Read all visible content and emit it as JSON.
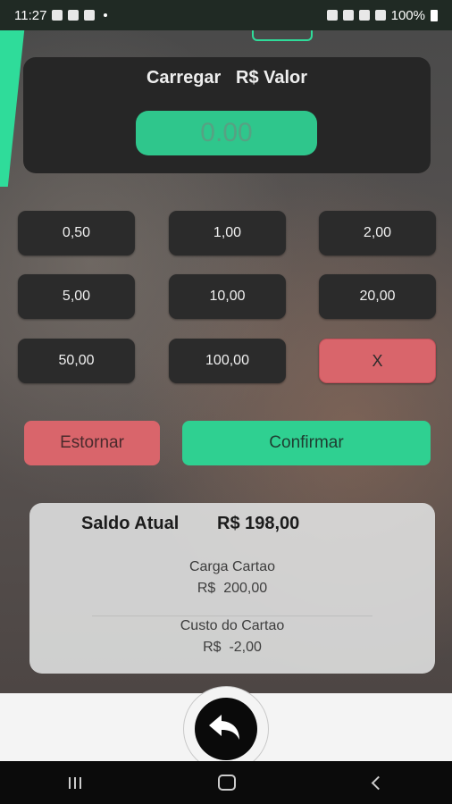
{
  "status_bar": {
    "time": "11:27",
    "battery": "100%"
  },
  "header": {
    "title_left": "Carregar",
    "title_right": "R$ Valor"
  },
  "amount_display": "0.00",
  "keypad": [
    [
      "0,50",
      "1,00",
      "2,00"
    ],
    [
      "5,00",
      "10,00",
      "20,00"
    ],
    [
      "50,00",
      "100,00",
      "X"
    ]
  ],
  "actions": {
    "estornar": "Estornar",
    "confirmar": "Confirmar"
  },
  "balance": {
    "label": "Saldo Atual",
    "value": "R$ 198,00",
    "carga_label": "Carga Cartao",
    "carga_value": "R$  200,00",
    "custo_label": "Custo do Cartao",
    "custo_value": "R$  -2,00"
  },
  "colors": {
    "accent": "#2fd091",
    "danger": "#d9656b",
    "panel": "#262626"
  }
}
